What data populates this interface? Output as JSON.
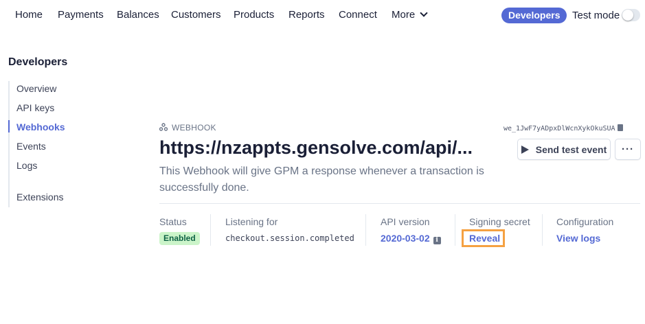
{
  "nav": {
    "items": [
      "Home",
      "Payments",
      "Balances",
      "Customers",
      "Products",
      "Reports",
      "Connect",
      "More"
    ],
    "developers": "Developers",
    "test_mode": "Test mode",
    "test_mode_on": false
  },
  "sidebar": {
    "title": "Developers",
    "items": [
      "Overview",
      "API keys",
      "Webhooks",
      "Events",
      "Logs",
      "Extensions"
    ],
    "active": "Webhooks"
  },
  "webhook": {
    "label": "WEBHOOK",
    "id": "we_1JwF7yADpxDlWcnXykOkuSUA",
    "url": "https://nzappts.gensolve.com/api/...",
    "description": "This Webhook will give GPM a response whenever a transaction is successfully done.",
    "send_test": "Send test event",
    "more": "···"
  },
  "details": {
    "status_label": "Status",
    "status_value": "Enabled",
    "listening_label": "Listening for",
    "listening_value": "checkout.session.completed",
    "api_label": "API version",
    "api_value": "2020-03-02",
    "secret_label": "Signing secret",
    "secret_value": "Reveal",
    "config_label": "Configuration",
    "config_value": "View logs"
  },
  "colors": {
    "accent": "#5469d4",
    "badge_bg": "#cbf4c9",
    "badge_text": "#0e6245",
    "highlight": "#f5a142"
  }
}
